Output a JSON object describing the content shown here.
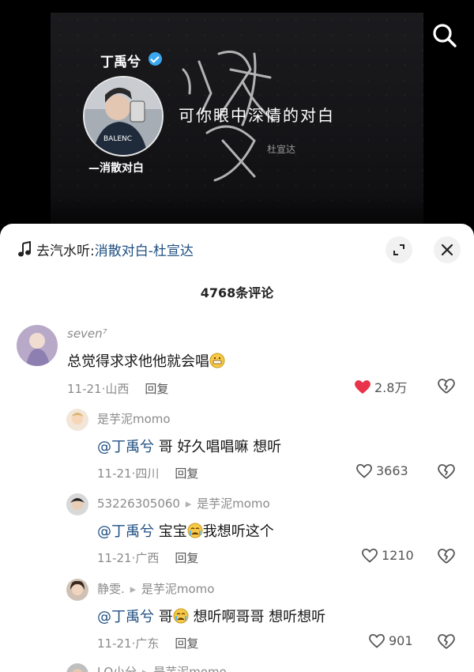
{
  "video": {
    "artist_name": "丁禹兮",
    "song_tag": "—消散对白",
    "lyric": "可你眼中深情的对白",
    "calligraphy_sub": "杜宣达"
  },
  "music_bar": {
    "prefix": "去汽水听:",
    "title": "消散对白-杜宣达"
  },
  "comment_count": "4768条评论",
  "comments": [
    {
      "username": "seven⁷",
      "text": "总觉得求求他他就会唱",
      "date": "11-21·山西",
      "reply_label": "回复",
      "likes": "2.8万",
      "liked": true
    },
    {
      "username": "是芋泥momo",
      "mention": "@丁禹兮",
      "text": " 哥 好久唱唱嘛 想听",
      "date": "11-21·四川",
      "reply_label": "回复",
      "likes": "3663",
      "liked": false
    },
    {
      "username": "53226305060",
      "reply_arrow": "▸",
      "reply_to": "是芋泥momo",
      "mention": "@丁禹兮",
      "text_a": " 宝宝",
      "text_b": "我想听这个",
      "date": "11-21·广西",
      "reply_label": "回复",
      "likes": "1210",
      "liked": false
    },
    {
      "username": "静雯.",
      "reply_arrow": "▸",
      "reply_to": "是芋泥momo",
      "mention": "@丁禹兮",
      "text_a": " 哥",
      "text_b": " 想听啊哥哥 想听想听",
      "date": "11-21·广东",
      "reply_label": "回复",
      "likes": "901",
      "liked": false
    },
    {
      "username": "LQ小分",
      "reply_arrow": "▸",
      "reply_to": "是芋泥momo"
    }
  ],
  "colors": {
    "mention": "#1f4f82",
    "like_active": "#e8334a",
    "muted": "#8a8a8a"
  }
}
